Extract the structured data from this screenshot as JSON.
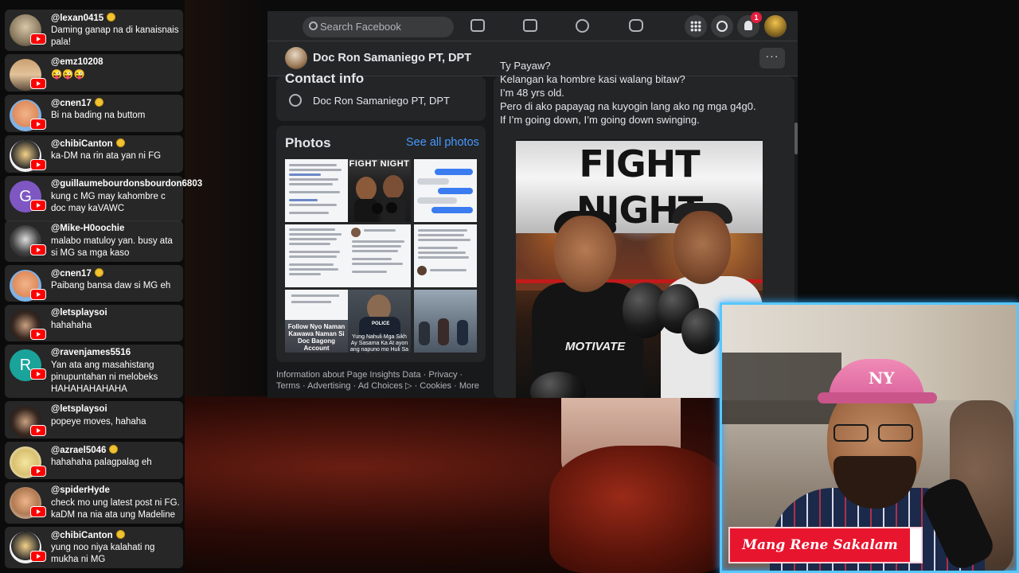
{
  "chat": [
    {
      "user": "@lexan0415",
      "verified": true,
      "text": "Daming ganap na di kanaisnais pala!",
      "avatar": "lex"
    },
    {
      "user": "@emz10208",
      "verified": false,
      "text": "😜😜😜",
      "avatar": "emz"
    },
    {
      "user": "@cnen17",
      "verified": true,
      "text": "Bi na bading na buttom",
      "avatar": "cnen"
    },
    {
      "user": "@chibiCanton",
      "verified": true,
      "text": "ka-DM na rin ata yan ni FG",
      "avatar": "chibi"
    },
    {
      "user": "@guillaumebourdonsbourdon6803",
      "verified": false,
      "text": "kung c MG may kahombre c doc may kaVAWC",
      "avatar": "G"
    },
    {
      "user": "@Mike-H0oochie",
      "verified": false,
      "text": "malabo matuloy yan. busy ata si MG sa mga kaso",
      "avatar": "mike"
    },
    {
      "user": "@cnen17",
      "verified": true,
      "text": "Paibang bansa daw si MG eh",
      "avatar": "cnen"
    },
    {
      "user": "@letsplaysoi",
      "verified": false,
      "text": "hahahaha",
      "avatar": "soi"
    },
    {
      "user": "@ravenjames5516",
      "verified": false,
      "text": "Yan ata ang masahistang pinupuntahan ni melobeks HAHAHAHAHAHA",
      "avatar": "R"
    },
    {
      "user": "@letsplaysoi",
      "verified": false,
      "text": "popeye moves, hahaha",
      "avatar": "soi"
    },
    {
      "user": "@azrael5046",
      "verified": true,
      "text": "hahahaha palagpalag eh",
      "avatar": "azrael"
    },
    {
      "user": "@spiderHyde",
      "verified": false,
      "text": "check mo ung latest post ni FG. kaDM na nia ata ung Madeline",
      "avatar": "spider"
    },
    {
      "user": "@chibiCanton",
      "verified": true,
      "text": "yung noo niya kalahati ng mukha ni MG",
      "avatar": "chibi"
    }
  ],
  "facebook": {
    "search_placeholder": "Search Facebook",
    "notification_count": "1",
    "profile_name": "Doc Ron Samaniego PT, DPT",
    "more_label": "···",
    "contact_title": "Contact info",
    "contact_messenger": "Doc Ron Samaniego PT, DPT",
    "photos_title": "Photos",
    "see_all": "See all photos",
    "photo_captions": {
      "fight_title": "FIGHT NIGHT",
      "meme": "Follow Nyo Naman Kawawa Naman Si Doc Bagong Account",
      "cop": "Yung Nahuli Mga Sikh Ay Sasama Ka At ayon ang napuno mo Huli Sa Entrapment",
      "cop_badge": "POLICE"
    },
    "footer": [
      "Information about Page Insights Data",
      "Privacy",
      "Terms",
      "Advertising",
      "Ad Choices",
      "Cookies",
      "More"
    ],
    "post_lines": [
      "Ty Payaw?",
      "Kelangan ka hombre kasi walang bitaw?",
      "I’m 48 yrs old.",
      "Pero di ako papayag na kuyogin lang ako ng mga g4g0.",
      "If I’m going down, I’m going down swinging."
    ],
    "poster": {
      "title": "FIGHT NIGHT",
      "shirt_text": "MOTIVATE"
    }
  },
  "streamer": {
    "name": "Mang Rene Sakalam",
    "cap_logo": "NY"
  },
  "colors": {
    "fb_bg": "#18191a",
    "fb_card": "#242526",
    "fb_link": "#4599ff",
    "yt_red": "#ff0000",
    "name_tag": "#e8152e",
    "cam_glow": "#57c7ff"
  }
}
